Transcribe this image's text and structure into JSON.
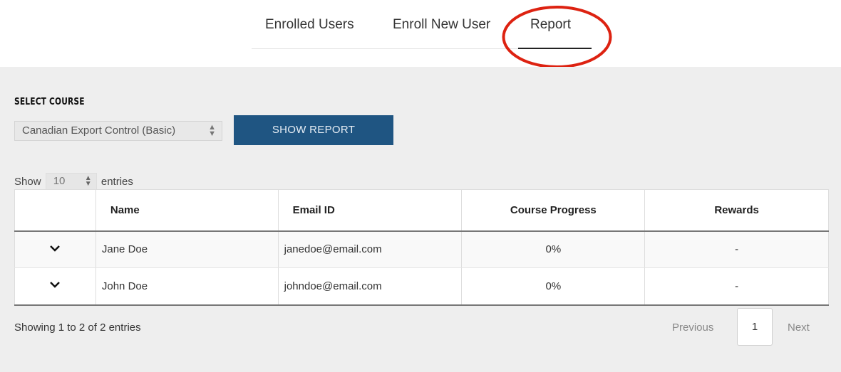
{
  "tabs": [
    {
      "label": "Enrolled Users",
      "active": false
    },
    {
      "label": "Enroll New User",
      "active": false
    },
    {
      "label": "Report",
      "active": true
    }
  ],
  "annotation": {
    "shape": "ellipse",
    "color": "#dd2211",
    "target": "Report tab"
  },
  "report": {
    "select_label": "SELECT COURSE",
    "course_selected": "Canadian Export Control (Basic)",
    "show_button": "SHOW REPORT",
    "accent_color": "#1f5582"
  },
  "entries": {
    "prefix": "Show",
    "value": "10",
    "suffix": "entries"
  },
  "table": {
    "columns": [
      "",
      "Name",
      "Email ID",
      "Course Progress",
      "Rewards"
    ],
    "rows": [
      {
        "name": "Jane Doe",
        "email": "janedoe@email.com",
        "progress": "0%",
        "rewards": "-",
        "expand_icon": "chevron-down-icon"
      },
      {
        "name": "John Doe",
        "email": "johndoe@email.com",
        "progress": "0%",
        "rewards": "-",
        "expand_icon": "chevron-down-icon"
      }
    ]
  },
  "footer": {
    "info": "Showing 1 to 2 of 2 entries",
    "previous": "Previous",
    "current_page": "1",
    "next": "Next"
  }
}
